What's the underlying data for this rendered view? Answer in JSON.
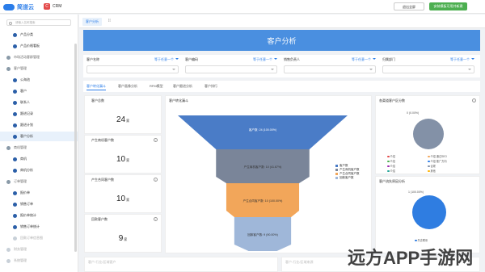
{
  "header": {
    "brand": "简道云",
    "app_badge": "C",
    "app_name": "CRM",
    "logout_label": "退出全屏",
    "green_button_label": "安装模板可用并新建"
  },
  "sidebar": {
    "search_placeholder": "请输入名称搜索",
    "items": [
      {
        "label": "产品分类",
        "type": "item",
        "indent": 2
      },
      {
        "label": "产品价格看板",
        "type": "item",
        "indent": 2
      },
      {
        "label": "市场活动客群管理",
        "type": "group",
        "indent": 1
      },
      {
        "label": "客户管理",
        "type": "group",
        "indent": 1
      },
      {
        "label": "公海池",
        "type": "item",
        "indent": 2
      },
      {
        "label": "客户",
        "type": "item",
        "indent": 2
      },
      {
        "label": "联系人",
        "type": "item",
        "indent": 2
      },
      {
        "label": "跟进记录",
        "type": "item",
        "indent": 2
      },
      {
        "label": "跟进计划",
        "type": "item",
        "indent": 2
      },
      {
        "label": "客户分析",
        "type": "item",
        "indent": 2,
        "active": true
      },
      {
        "label": "商机管理",
        "type": "group",
        "indent": 1
      },
      {
        "label": "商机",
        "type": "item",
        "indent": 2
      },
      {
        "label": "商机分析",
        "type": "item",
        "indent": 2
      },
      {
        "label": "订单管理",
        "type": "group",
        "indent": 1
      },
      {
        "label": "报价单",
        "type": "item",
        "indent": 2
      },
      {
        "label": "销售订单",
        "type": "item",
        "indent": 2
      },
      {
        "label": "报价单统计",
        "type": "item",
        "indent": 2
      },
      {
        "label": "销售订单统计",
        "type": "item",
        "indent": 2
      },
      {
        "label": "回款订单信息图",
        "type": "item",
        "indent": 2,
        "muted": true
      },
      {
        "label": "财务管理",
        "type": "group",
        "indent": 1,
        "muted": true
      },
      {
        "label": "系统管理",
        "type": "group",
        "indent": 1,
        "muted": true
      }
    ]
  },
  "tabs": [
    {
      "label": "客户分析"
    }
  ],
  "banner": {
    "title": "客户分析"
  },
  "filters": [
    {
      "label": "客户名称",
      "link": "等于任意一个"
    },
    {
      "label": "客户编码",
      "link": "等于任意一个"
    },
    {
      "label": "销售负责人",
      "link": "等于任意一个"
    },
    {
      "label": "归属部门",
      "link": "等于任意一个"
    }
  ],
  "subtabs": [
    "客户转化漏斗",
    "客户画像分析",
    "RFM模型",
    "客户跟进分析",
    "客户排行"
  ],
  "stats": [
    {
      "title": "客户总数",
      "value": "24",
      "unit": "家"
    },
    {
      "title": "产生商机客户数",
      "value": "10",
      "unit": "家"
    },
    {
      "title": "产生合同客户数",
      "value": "10",
      "unit": "家"
    },
    {
      "title": "回款客户数",
      "value": "9",
      "unit": "家"
    }
  ],
  "funnel": {
    "title": "客户转化漏斗",
    "legend": [
      "客户数",
      "产生商机客户数",
      "产生合同客户数",
      "回款客户数"
    ]
  },
  "chart_data": {
    "type": "funnel",
    "title": "客户转化漏斗",
    "categories": [
      "客户数",
      "产生商机客户数",
      "产生合同客户数",
      "回款客户数"
    ],
    "values": [
      24,
      10,
      10,
      9
    ],
    "labels": [
      "客户数: 24 (100.00%)",
      "产生商机客户数: 10 (41.67%)",
      "产生合同客户数: 10 (100.00%)",
      "回款客户数: 9 (90.00%)"
    ],
    "colors": [
      "#4a7cc7",
      "#7a8599",
      "#f2a65a",
      "#9fb7d9"
    ]
  },
  "pie1": {
    "title": "各渠道客户区分数",
    "label": "0 (0.00%)",
    "legend": [
      "介绍",
      "介绍 通过SEO",
      "介绍",
      "介绍 推广方向",
      "介绍",
      "合规",
      "介绍",
      "其他"
    ]
  },
  "pie2": {
    "title": "客户流失原因分析",
    "label": "1 (100.00%)",
    "legend": [
      "失去联系"
    ]
  },
  "bottom_titles": [
    "客户-行业/区域客户",
    "客户-行业/区域来源",
    "客户-行业",
    "客户行业占比"
  ]
}
